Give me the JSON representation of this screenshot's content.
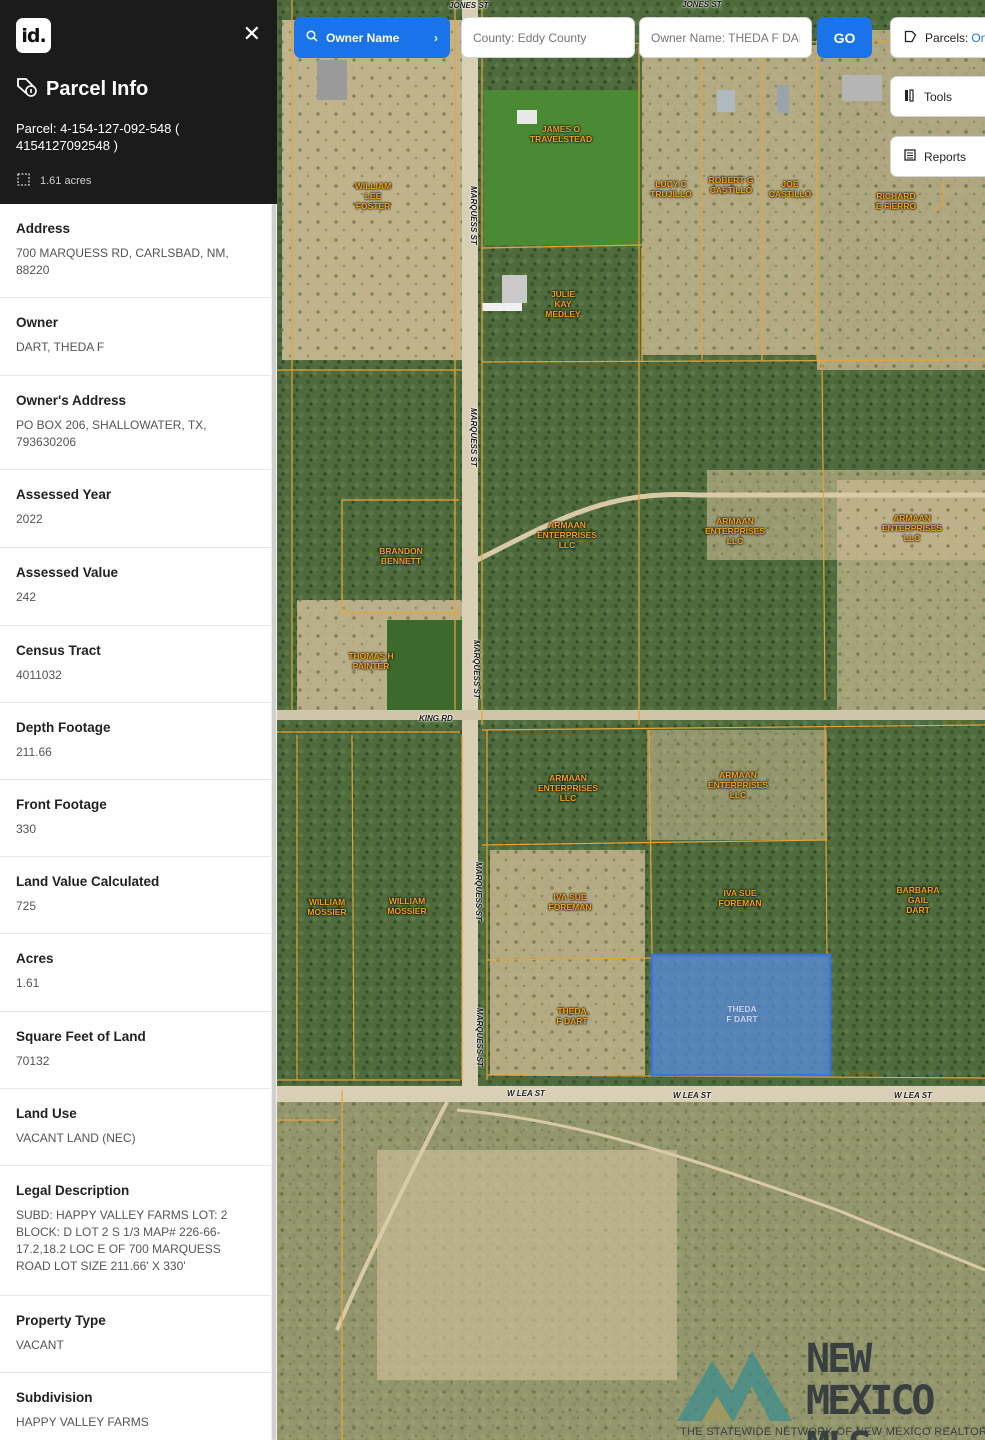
{
  "panel": {
    "logo": "id.",
    "title": "Parcel Info",
    "parcel_line": "Parcel: 4-154-127-092-548 ( 4154127092548 )",
    "acres_badge": "1.61 acres",
    "fields": [
      {
        "label": "Address",
        "value": "700 MARQUESS RD, CARLSBAD, NM, 88220"
      },
      {
        "label": "Owner",
        "value": "DART, THEDA F"
      },
      {
        "label": "Owner's Address",
        "value": "PO BOX 206, SHALLOWATER, TX, 793630206"
      },
      {
        "label": "Assessed Year",
        "value": "2022"
      },
      {
        "label": "Assessed Value",
        "value": "242"
      },
      {
        "label": "Census Tract",
        "value": "4011032"
      },
      {
        "label": "Depth Footage",
        "value": "211.66"
      },
      {
        "label": "Front Footage",
        "value": "330"
      },
      {
        "label": "Land Value Calculated",
        "value": "725"
      },
      {
        "label": "Acres",
        "value": "1.61"
      },
      {
        "label": "Square Feet of Land",
        "value": "70132"
      },
      {
        "label": "Land Use",
        "value": "VACANT LAND (NEC)"
      },
      {
        "label": "Legal Description",
        "value": "SUBD: HAPPY VALLEY FARMS LOT: 2 BLOCK: D LOT 2 S 1/3 MAP# 226-66-17.2,18.2 LOC E OF 700 MARQUESS ROAD LOT SIZE 211.66' X 330'"
      },
      {
        "label": "Property Type",
        "value": "VACANT"
      },
      {
        "label": "Subdivision",
        "value": "HAPPY VALLEY FARMS"
      }
    ]
  },
  "toolbar": {
    "search_mode": "Owner Name",
    "county_field": "County: Eddy County",
    "owner_field": "Owner Name: THEDA F DAR",
    "go_label": "GO",
    "parcels_label": "Parcels:",
    "parcels_state": "On",
    "tools_label": "Tools",
    "reports_label": "Reports"
  },
  "map": {
    "roads": [
      "JONES ST",
      "JONES ST",
      "MARQUESS ST",
      "MARQUESS ST",
      "MARQUESS ST",
      "MARQUESS ST",
      "MARQUESS ST",
      "KING RD",
      "W LEA ST",
      "W LEA ST",
      "W LEA ST"
    ],
    "owners": [
      "JAMES O\nTRAVELSTEAD",
      "WILLIAM\nLEE\nFOSTER",
      "LUCY C\nTRUJILLO",
      "ROBERT G\nCASTILLO",
      "JOE\nCASTILLO",
      "RICHARD\nE FIERRO",
      "JULIE\nKAY\nMEDLEY",
      "ARMAAN\nENTERPRISES\nLLC",
      "ARMAAN\nENTERPRISES\nLLC",
      "ARMAAN\nENTERPRISES\nLLC",
      "BRANDON\nBENNETT",
      "THOMAS H\nPAINTER",
      "ARMAAN\nENTERPRISES\nLLC",
      "ARMAAN\nENTERPRISES\nLLC",
      "WILLIAM\nMOSSIER",
      "WILLIAM\nMOSSIER",
      "IVA SUE\nFOREMAN",
      "IVA SUE\nFOREMAN",
      "BARBARA\nGAIL\nDART",
      "THEDA\nF DART",
      "THEDA\nF DART"
    ],
    "selected_parcel_owner": "THEDA\nF DART",
    "colors": {
      "parcel_line": "#e3a53a",
      "selected_fill": "#5a8fe6",
      "label": "#f4a21a"
    }
  },
  "watermark": {
    "line1": "NEW",
    "line2": "MEXICO MLS",
    "tagline": "THE STATEWIDE NETWORK OF NEW MEXICO REALTORS®"
  }
}
